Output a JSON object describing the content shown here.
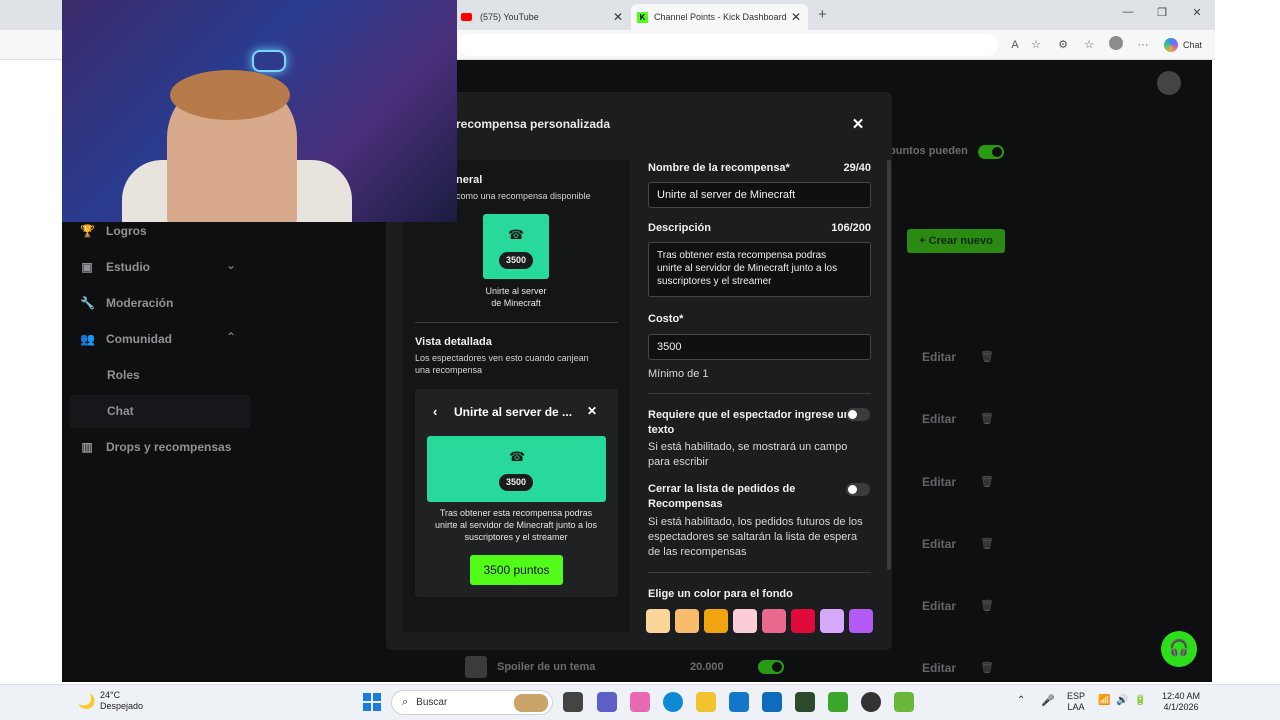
{
  "browser": {
    "tabs": [
      {
        "label": "(575) YouTube",
        "icon": "youtube-icon",
        "active": false
      },
      {
        "label": "Channel Points - Kick Dashboard",
        "icon": "kick-icon",
        "active": true
      }
    ],
    "toolbar_right_label": "Chat"
  },
  "sidebar": {
    "items": [
      {
        "label": "Logros",
        "icon": "trophy-icon"
      },
      {
        "label": "Estudio",
        "icon": "studio-icon"
      },
      {
        "label": "Moderación",
        "icon": "wrench-icon"
      },
      {
        "label": "Comunidad",
        "icon": "community-icon"
      },
      {
        "label": "Roles"
      },
      {
        "label": "Chat"
      },
      {
        "label": "Drops y recompensas",
        "icon": "drops-icon"
      }
    ]
  },
  "background": {
    "points_text": "puntos pueden",
    "create_button": "+ Crear nuevo",
    "edit_label": "Editar",
    "row_name": "Spoiler de un tema",
    "row_points": "20.000"
  },
  "modal": {
    "title": "recompensa personalizada",
    "general_heading": "neral",
    "general_sub": "como una recompensa disponible",
    "cost_value": "3500",
    "reward_name": "Unirte al server de Minecraft",
    "card_name_line1": "Unirte al server",
    "card_name_line2": "de Minecraft",
    "detail_heading": "Vista detallada",
    "detail_sub_line1": "Los espectadores ven esto cuando canjean",
    "detail_sub_line2": "una recompensa",
    "preview_title": "Unirte al server de ...",
    "preview_desc_line1": "Tras obtener esta recompensa podras",
    "preview_desc_line2": "unirte al servidor de Minecraft junto a los",
    "preview_desc_line3": "suscriptores y el streamer",
    "preview_button": "3500 puntos",
    "name_label": "Nombre de la recompensa*",
    "name_count": "29/40",
    "desc_label": "Descripción",
    "desc_count": "106/200",
    "desc_line1": "Tras obtener esta recompensa podras",
    "desc_line2": "unirte al servidor de Minecraft junto a los",
    "desc_line3": "suscriptores y el streamer",
    "cost_label": "Costo*",
    "cost_hint": "Mínimo de 1",
    "req_text_label_1": "Requiere que el espectador ingrese un",
    "req_text_label_2": "texto",
    "req_text_help_1": "Si está habilitado, se mostrará un campo",
    "req_text_help_2": "para escribir",
    "close_list_label_1": "Cerrar la lista de pedidos de",
    "close_list_label_2": "Recompensas",
    "close_list_help_1": "Si está habilitado, los pedidos futuros de los",
    "close_list_help_2": "espectadores se saltarán la lista de espera",
    "close_list_help_3": "de las recompensas",
    "color_label": "Elige un color para el fondo",
    "swatch_colors": [
      "#fcd59a",
      "#f9bb6c",
      "#f2a410",
      "#fbcdd8",
      "#e96a8c",
      "#e00b3a",
      "#d5a8fb",
      "#b25af4"
    ],
    "accent_color": "#27d99a",
    "button_color": "#53fc18"
  },
  "taskbar": {
    "weather_temp": "24°C",
    "weather_desc": "Despejado",
    "search_placeholder": "Buscar",
    "lang_1": "ESP",
    "lang_2": "LAA",
    "time": "12:40 AM",
    "date": "4/1/2026"
  }
}
